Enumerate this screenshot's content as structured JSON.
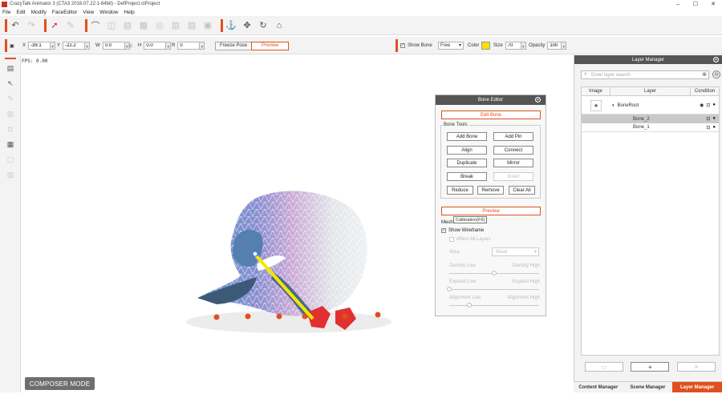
{
  "title": "CrazyTalk Animator 3  (CTA3 2016.07.22.1-64bit) - DefProject.ctProject",
  "window_controls": [
    "–",
    "☐",
    "✕"
  ],
  "menu": [
    "File",
    "Edit",
    "Modify",
    "FaceEditor",
    "View",
    "Window",
    "Help"
  ],
  "transform": {
    "x_label": "X",
    "x_value": "-39.1",
    "y_label": "Y",
    "y_value": "-22.2",
    "w_label": "W",
    "w_value": "0.0",
    "h_label": "H",
    "h_value": "0.0",
    "r_label": "R",
    "r_value": "0",
    "freeze_pose": "Freeze Pose",
    "preview": "Preview"
  },
  "bone_display": {
    "show_bone_label": "Show Bone",
    "mode_value": "Free",
    "color_label": "Color",
    "color_value": "#ffe000",
    "size_label": "Size",
    "size_value": "70",
    "opacity_label": "Opacity",
    "opacity_value": "100"
  },
  "fps": "FPS: 0.00",
  "composer_mode": "COMPOSER MODE",
  "bone_editor": {
    "title": "Bone Editor",
    "edit_bone": "Edit Bone",
    "tools_label": "Bone Tools",
    "buttons": {
      "add_bone": "Add Bone",
      "add_pin": "Add Pin",
      "align": "Align",
      "connect": "Connect",
      "duplicate": "Duplicate",
      "mirror": "Mirror",
      "break": "Break",
      "insert": "Insert",
      "reduce": "Reduce",
      "remove": "Remove",
      "clear_all": "Clear All"
    },
    "preview": "Preview",
    "mesh_subdivision": "Mesh Subd",
    "tooltip": "Calibration(F6)",
    "show_wireframe": "Show Wireframe",
    "affect_all_layers": "Affect All Layers",
    "area_label": "Area",
    "area_value": "Mask",
    "density_low": "Density Low",
    "density_high": "Density High",
    "density_level": 0.5,
    "expand_low": "Expand Low",
    "expand_high": "Expand High",
    "expand_level": 0.0,
    "alignment_low": "Alignment Low",
    "alignment_high": "Alignment High",
    "alignment_level": 0.22
  },
  "layer_manager": {
    "title": "Layer Manager",
    "search_placeholder": "Enter layer search",
    "col_image": "Image",
    "col_layer": "Layer",
    "col_condition": "Condition",
    "layers": [
      {
        "name": "BoneRoot",
        "selected": false
      },
      {
        "name": "Bone_2",
        "selected": true
      },
      {
        "name": "Bone_1",
        "selected": false
      }
    ],
    "add_button": "+"
  },
  "bottom_tabs": [
    "Content Manager",
    "Scene Manager",
    "Layer Manager"
  ],
  "colors": {
    "accent": "#e0501e",
    "panel_header": "#555555"
  }
}
